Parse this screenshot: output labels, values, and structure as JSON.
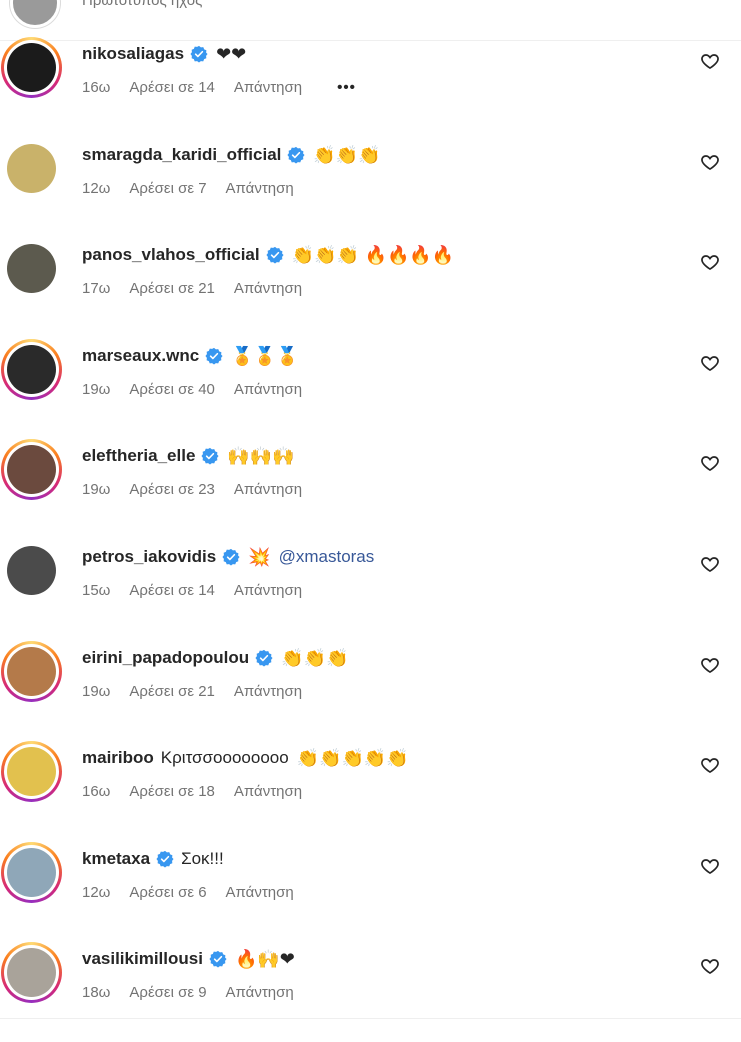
{
  "header": {
    "text": "Πρωτότυπος ήχος"
  },
  "colors": {
    "verified": "#3897f0",
    "mention": "#385898",
    "heart_red": "#ed4956"
  },
  "comments": [
    {
      "username": "nikosaliagas",
      "verified": true,
      "text": "",
      "mention": "",
      "emojis": "❤❤",
      "time": "16ω",
      "likes": "Αρέσει σε 14",
      "reply": "Απάντηση",
      "more": "•••",
      "avatar_color": "#1b1b1b"
    },
    {
      "username": "smaragda_karidi_official",
      "verified": true,
      "text": "",
      "mention": "",
      "emojis": "👏👏👏",
      "time": "12ω",
      "likes": "Αρέσει σε 7",
      "reply": "Απάντηση",
      "more": "",
      "avatar_color": "#c9b26a"
    },
    {
      "username": "panos_vlahos_official",
      "verified": true,
      "text": "",
      "mention": "",
      "emojis": "👏👏👏 🔥🔥🔥🔥",
      "time": "17ω",
      "likes": "Αρέσει σε 21",
      "reply": "Απάντηση",
      "more": "",
      "avatar_color": "#5c5a4e"
    },
    {
      "username": "marseaux.wnc",
      "verified": true,
      "text": "",
      "mention": "",
      "emojis": "🏅🏅🏅",
      "time": "19ω",
      "likes": "Αρέσει σε 40",
      "reply": "Απάντηση",
      "more": "",
      "avatar_color": "#2a2a2a"
    },
    {
      "username": "eleftheria_elle",
      "verified": true,
      "text": "",
      "mention": "",
      "emojis": "🙌🙌🙌",
      "time": "19ω",
      "likes": "Αρέσει σε 23",
      "reply": "Απάντηση",
      "more": "",
      "avatar_color": "#6b4a3e"
    },
    {
      "username": "petros_iakovidis",
      "verified": true,
      "text": "",
      "mention": "@xmastoras",
      "emojis": "💥",
      "time": "15ω",
      "likes": "Αρέσει σε 14",
      "reply": "Απάντηση",
      "more": "",
      "avatar_color": "#4b4b4b"
    },
    {
      "username": "eirini_papadopoulou",
      "verified": true,
      "text": "",
      "mention": "",
      "emojis": "👏👏👏",
      "time": "19ω",
      "likes": "Αρέσει σε 21",
      "reply": "Απάντηση",
      "more": "",
      "avatar_color": "#b47a4a"
    },
    {
      "username": "mairiboo",
      "verified": false,
      "text": "Κριτσσοοοοοοοο",
      "mention": "",
      "emojis": "👏👏👏👏👏",
      "time": "16ω",
      "likes": "Αρέσει σε 18",
      "reply": "Απάντηση",
      "more": "",
      "avatar_color": "#e2c14e"
    },
    {
      "username": "kmetaxa",
      "verified": true,
      "text": "Σοκ!!!",
      "mention": "",
      "emojis": "",
      "time": "12ω",
      "likes": "Αρέσει σε 6",
      "reply": "Απάντηση",
      "more": "",
      "avatar_color": "#8fa7b8"
    },
    {
      "username": "vasilikimillousi",
      "verified": true,
      "text": "",
      "mention": "",
      "emojis": "🔥🙌❤",
      "time": "18ω",
      "likes": "Αρέσει σε 9",
      "reply": "Απάντηση",
      "more": "",
      "avatar_color": "#a9a39a"
    }
  ]
}
